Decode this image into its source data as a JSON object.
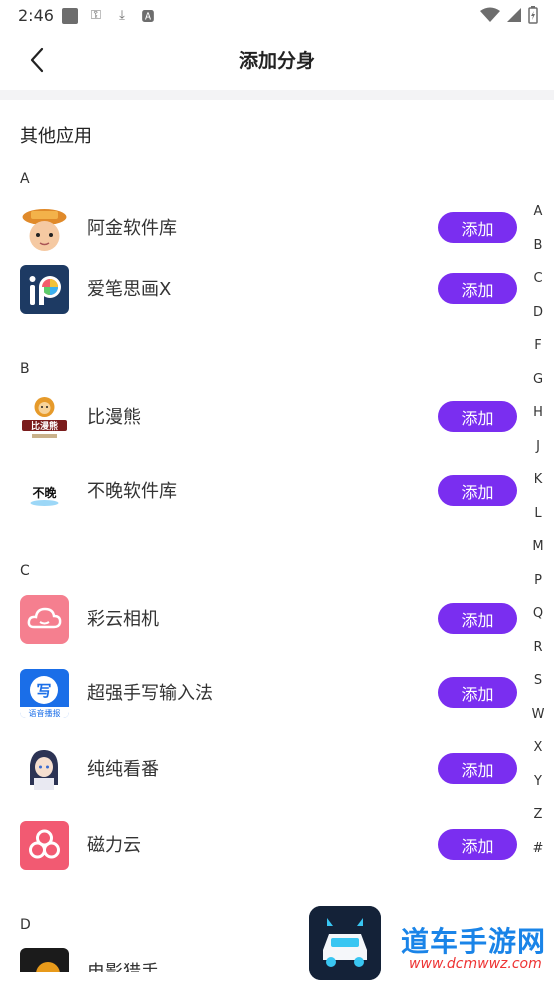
{
  "status_bar": {
    "time": "2:46"
  },
  "nav": {
    "title": "添加分身",
    "back_icon": "chevron-left-icon"
  },
  "section_title": "其他应用",
  "add_label": "添加",
  "groups": [
    {
      "letter": "A",
      "apps": [
        {
          "name": "阿金软件库",
          "icon": "ajin-app-icon"
        },
        {
          "name": "爱笔思画X",
          "icon": "ibispaint-app-icon"
        }
      ]
    },
    {
      "letter": "B",
      "apps": [
        {
          "name": "比漫熊",
          "icon": "bimanxiong-app-icon"
        },
        {
          "name": "不晚软件库",
          "icon": "buwan-app-icon"
        }
      ]
    },
    {
      "letter": "C",
      "apps": [
        {
          "name": "彩云相机",
          "icon": "caiyun-camera-app-icon"
        },
        {
          "name": "超强手写输入法",
          "icon": "handwriting-app-icon"
        },
        {
          "name": "纯纯看番",
          "icon": "chunchun-app-icon"
        },
        {
          "name": "磁力云",
          "icon": "ciliyun-app-icon"
        }
      ]
    },
    {
      "letter": "D",
      "apps": [
        {
          "name": "电影猎手",
          "icon": "movie-hunter-app-icon"
        }
      ]
    }
  ],
  "index_letters": [
    "A",
    "B",
    "C",
    "D",
    "F",
    "G",
    "H",
    "J",
    "K",
    "L",
    "M",
    "P",
    "Q",
    "R",
    "S",
    "W",
    "X",
    "Y",
    "Z",
    "#"
  ],
  "watermark": {
    "text": "道车手游网",
    "url": "www.dcmwwz.com"
  }
}
